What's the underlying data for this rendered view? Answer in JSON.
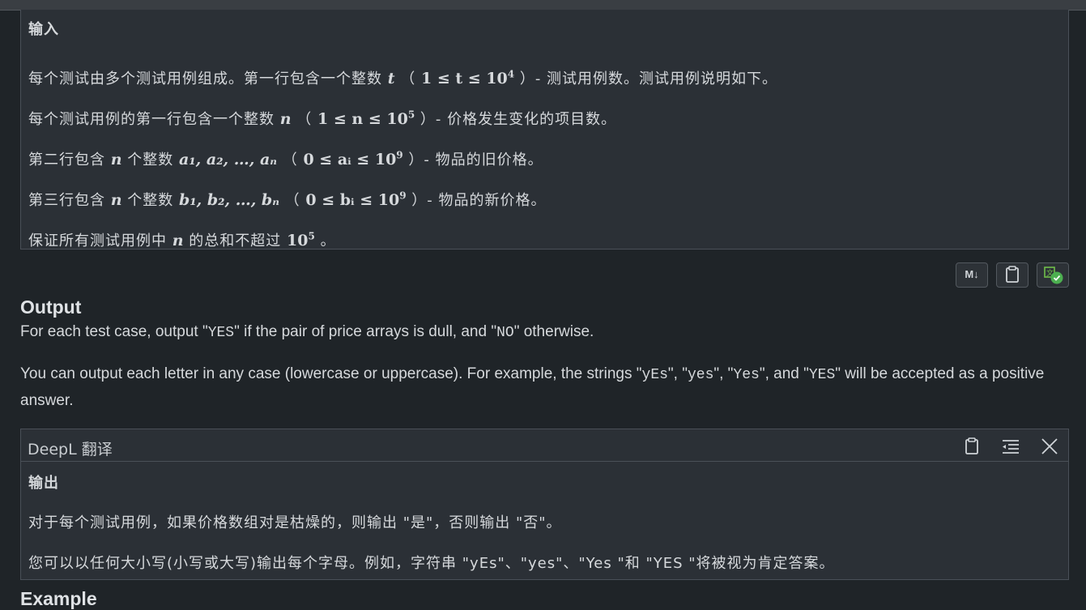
{
  "input_panel": {
    "heading": "输入",
    "line1": {
      "pre": "每个测试由多个测试用例组成。第一行包含一个整数",
      "var": "t",
      "open": "（",
      "math": "1 ≤ t ≤ 10",
      "exp": "4",
      "post": "）- 测试用例数。测试用例说明如下。"
    },
    "line2": {
      "pre": "每个测试用例的第一行包含一个整数",
      "var": "n",
      "open": "（",
      "math": "1 ≤ n ≤ 10",
      "exp": "5",
      "post": "）- 价格发生变化的项目数。"
    },
    "line3": {
      "pre": "第二行包含",
      "var": "n",
      "mid": "个整数",
      "seq": "a₁, a₂, …, aₙ",
      "open": "（",
      "math": "0 ≤ aᵢ ≤ 10",
      "exp": "9",
      "post": "）- 物品的旧价格。"
    },
    "line4": {
      "pre": "第三行包含",
      "var": "n",
      "mid": "个整数",
      "seq": "b₁, b₂, …, bₙ",
      "open": "（",
      "math": "0 ≤ bᵢ ≤ 10",
      "exp": "9",
      "post": "）- 物品的新价格。"
    },
    "line5": {
      "pre": "保证所有测试用例中",
      "var": "n",
      "mid": "的总和不超过",
      "math": "10",
      "exp": "5",
      "post": "。"
    }
  },
  "toolbar": {
    "md_label": "M↓",
    "copy_icon": "clipboard-icon",
    "translate_icon": "translate-check-icon"
  },
  "output": {
    "title": "Output",
    "p1": {
      "a": "For each test case, output \"",
      "yes": "YES",
      "b": "\" if the pair of price arrays is dull, and \"",
      "no": "NO",
      "c": "\" otherwise."
    },
    "p2": {
      "a": "You can output each letter in any case (lowercase or uppercase). For example, the strings \"",
      "s1": "yEs",
      "b": "\", \"",
      "s2": "yes",
      "c": "\", \"",
      "s3": "Yes",
      "d": "\", and \"",
      "s4": "YES",
      "e": "\" will be accepted as a positive answer."
    }
  },
  "deepl_panel": {
    "title": "DeepL 翻译",
    "heading": "输出",
    "line1": "对于每个测试用例，如果价格数组对是枯燥的，则输出 \"是\"，否则输出 \"否\"。",
    "line2": "您可以以任何大小写(小写或大写)输出每个字母。例如，字符串 \"yEs\"、\"yes\"、\"Yes \"和 \"YES \"将被视为肯定答案。"
  },
  "next_section": {
    "title": "Example"
  }
}
